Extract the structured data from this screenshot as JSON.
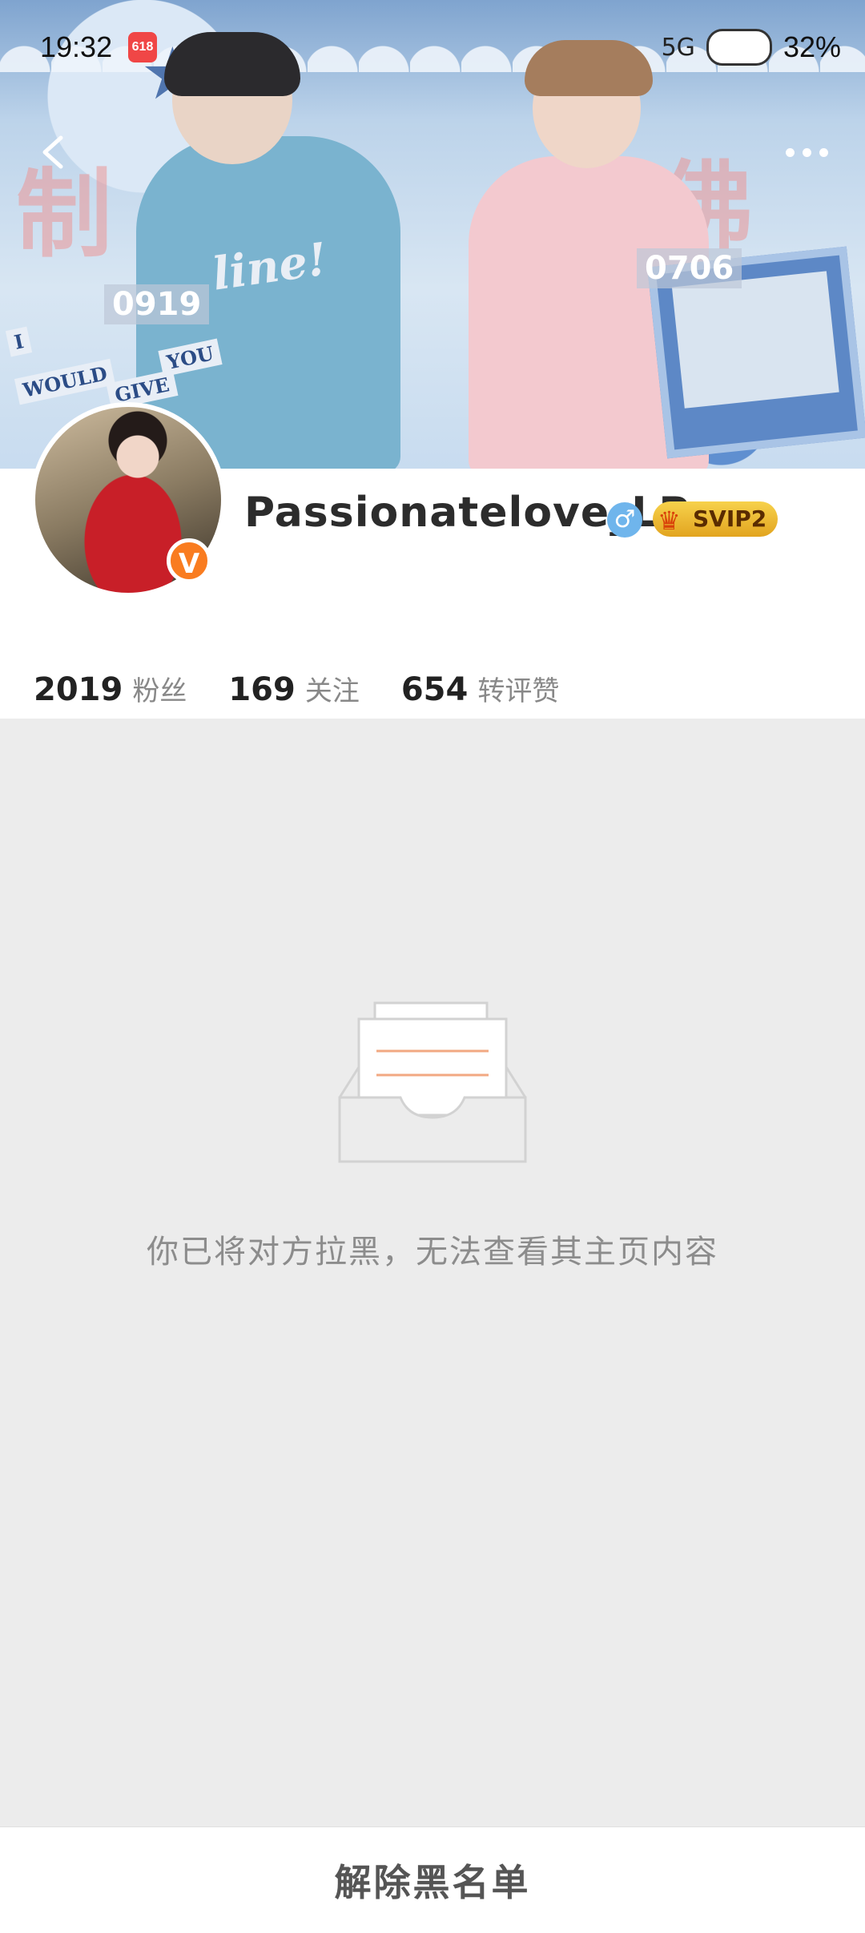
{
  "status_bar": {
    "time": "19:32",
    "app_icon_text": "618",
    "network": "5G",
    "battery": "32%"
  },
  "banner": {
    "stamp_left": "0919",
    "stamp_right": "0706",
    "sweater_text": "line!",
    "words": [
      "I",
      "WOULD",
      "GIVE",
      "YOU"
    ]
  },
  "profile": {
    "username": "Passionatelove_LP",
    "gender_symbol": "♂",
    "svip_label": "SVIP2",
    "verified_symbol": "V"
  },
  "stats": [
    {
      "value": "2019",
      "label": "粉丝"
    },
    {
      "value": "169",
      "label": "关注"
    },
    {
      "value": "654",
      "label": "转评赞"
    }
  ],
  "empty_state": {
    "message": "你已将对方拉黑，无法查看其主页内容"
  },
  "bottom": {
    "unblock_label": "解除黑名单"
  },
  "colors": {
    "verified": "#f97c20",
    "gender": "#6fb5ec",
    "svip": "#e2a41f",
    "accent_line": "#f2a882"
  },
  "icons": [
    "back-arrow-icon",
    "more-dots-icon",
    "inbox-empty-icon",
    "crown-icon",
    "cloud-icon"
  ]
}
